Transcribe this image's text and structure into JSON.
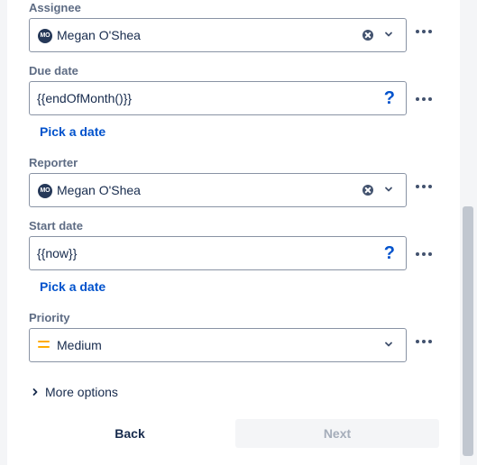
{
  "assignee": {
    "label": "Assignee",
    "value": "Megan O'Shea",
    "avatar_initials": "MO"
  },
  "due_date": {
    "label": "Due date",
    "value": "{{endOfMonth()}}",
    "help": "?",
    "pick_link": "Pick a date"
  },
  "reporter": {
    "label": "Reporter",
    "value": "Megan O'Shea",
    "avatar_initials": "MO"
  },
  "start_date": {
    "label": "Start date",
    "value": "{{now}}",
    "help": "?",
    "pick_link": "Pick a date"
  },
  "priority": {
    "label": "Priority",
    "value": "Medium",
    "icon_color": "#ffab00"
  },
  "more_options": "More options",
  "footer": {
    "back_label": "Back",
    "next_label": "Next"
  },
  "colors": {
    "link": "#0052cc",
    "text": "#172b4d",
    "label": "#5e6c84",
    "disabled": "#a5adba"
  },
  "icons": [
    "avatar",
    "clear-icon",
    "chevron-down-icon",
    "help-icon",
    "more-icon",
    "priority-medium-icon",
    "chevron-right-icon"
  ]
}
